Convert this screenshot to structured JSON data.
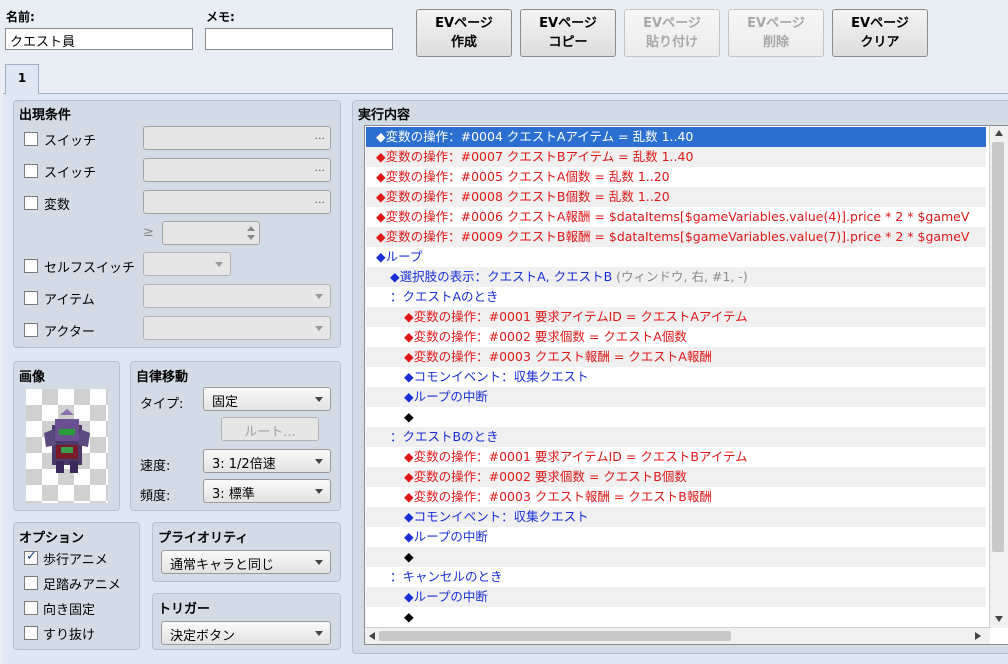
{
  "header": {
    "name_label": "名前:",
    "name_value": "クエスト員",
    "memo_label": "メモ:",
    "memo_value": ""
  },
  "toolbar": {
    "buttons": [
      {
        "line1": "EVページ",
        "line2": "作成",
        "enabled": true
      },
      {
        "line1": "EVページ",
        "line2": "コピー",
        "enabled": true
      },
      {
        "line1": "EVページ",
        "line2": "貼り付け",
        "enabled": false
      },
      {
        "line1": "EVページ",
        "line2": "削除",
        "enabled": false
      },
      {
        "line1": "EVページ",
        "line2": "クリア",
        "enabled": true
      }
    ]
  },
  "tabs": [
    {
      "label": "1"
    }
  ],
  "conditions": {
    "title": "出現条件",
    "switch1": "スイッチ",
    "switch2": "スイッチ",
    "variable": "変数",
    "ge_symbol": "≥",
    "self_switch": "セルフスイッチ",
    "item": "アイテム",
    "actor": "アクター",
    "dots": "..."
  },
  "image": {
    "title": "画像"
  },
  "autonomous": {
    "title": "自律移動",
    "type_label": "タイプ:",
    "type_value": "固定",
    "route_button": "ルート...",
    "speed_label": "速度:",
    "speed_value": "3: 1/2倍速",
    "freq_label": "頻度:",
    "freq_value": "3: 標準"
  },
  "options": {
    "title": "オプション",
    "items": [
      {
        "label": "歩行アニメ",
        "checked": true
      },
      {
        "label": "足踏みアニメ",
        "checked": false
      },
      {
        "label": "向き固定",
        "checked": false
      },
      {
        "label": "すり抜け",
        "checked": false
      }
    ]
  },
  "priority": {
    "title": "プライオリティ",
    "value": "通常キャラと同じ"
  },
  "trigger": {
    "title": "トリガー",
    "value": "決定ボタン"
  },
  "contents": {
    "title": "実行内容",
    "lines": [
      {
        "text": "◆変数の操作：#0004 クエストAアイテム = 乱数 1..40",
        "color": "red",
        "indent": 0,
        "selected": true
      },
      {
        "text": "◆変数の操作：#0007 クエストBアイテム = 乱数 1..40",
        "color": "red",
        "indent": 0
      },
      {
        "text": "◆変数の操作：#0005 クエストA個数 = 乱数 1..20",
        "color": "red",
        "indent": 0
      },
      {
        "text": "◆変数の操作：#0008 クエストB個数 = 乱数 1..20",
        "color": "red",
        "indent": 0
      },
      {
        "text": "◆変数の操作：#0006 クエストA報酬 = $dataItems[$gameVariables.value(4)].price * 2 * $gameV",
        "color": "red",
        "indent": 0
      },
      {
        "text": "◆変数の操作：#0009 クエストB報酬 = $dataItems[$gameVariables.value(7)].price * 2 * $gameV",
        "color": "red",
        "indent": 0
      },
      {
        "text": "◆ループ",
        "color": "blue",
        "indent": 0
      },
      {
        "text": "◆選択肢の表示：クエストA, クエストB",
        "suffix": " (ウィンドウ, 右, #1, -)",
        "color": "blue",
        "indent": 1
      },
      {
        "text": "：クエストAのとき",
        "color": "blue",
        "indent": 1
      },
      {
        "text": "◆変数の操作：#0001 要求アイテムID = クエストAアイテム",
        "color": "red",
        "indent": 2
      },
      {
        "text": "◆変数の操作：#0002 要求個数 = クエストA個数",
        "color": "red",
        "indent": 2
      },
      {
        "text": "◆変数の操作：#0003 クエスト報酬 = クエストA報酬",
        "color": "red",
        "indent": 2
      },
      {
        "text": "◆コモンイベント：収集クエスト",
        "color": "blue",
        "indent": 2
      },
      {
        "text": "◆ループの中断",
        "color": "blue",
        "indent": 2
      },
      {
        "text": "◆",
        "color": "black",
        "indent": 2
      },
      {
        "text": "：クエストBのとき",
        "color": "blue",
        "indent": 1
      },
      {
        "text": "◆変数の操作：#0001 要求アイテムID = クエストBアイテム",
        "color": "red",
        "indent": 2
      },
      {
        "text": "◆変数の操作：#0002 要求個数 = クエストB個数",
        "color": "red",
        "indent": 2
      },
      {
        "text": "◆変数の操作：#0003 クエスト報酬 = クエストB報酬",
        "color": "red",
        "indent": 2
      },
      {
        "text": "◆コモンイベント：収集クエスト",
        "color": "blue",
        "indent": 2
      },
      {
        "text": "◆ループの中断",
        "color": "blue",
        "indent": 2
      },
      {
        "text": "◆",
        "color": "black",
        "indent": 2
      },
      {
        "text": "：キャンセルのとき",
        "color": "blue",
        "indent": 1
      },
      {
        "text": "◆ループの中断",
        "color": "blue",
        "indent": 2
      },
      {
        "text": "◆",
        "color": "black",
        "indent": 2
      }
    ]
  },
  "colors": {
    "command_red": "#e01818",
    "command_blue": "#1a2fd8",
    "selection": "#2b6fd0",
    "panel": "#d3dbe7"
  },
  "icons": {
    "dropdown": "chevron-down-icon",
    "scroll_up": "triangle-up-icon",
    "scroll_down": "triangle-down-icon",
    "scroll_left": "triangle-left-icon",
    "scroll_right": "triangle-right-icon",
    "spin": "spinner-arrows-icon",
    "check": "checkmark-icon"
  }
}
